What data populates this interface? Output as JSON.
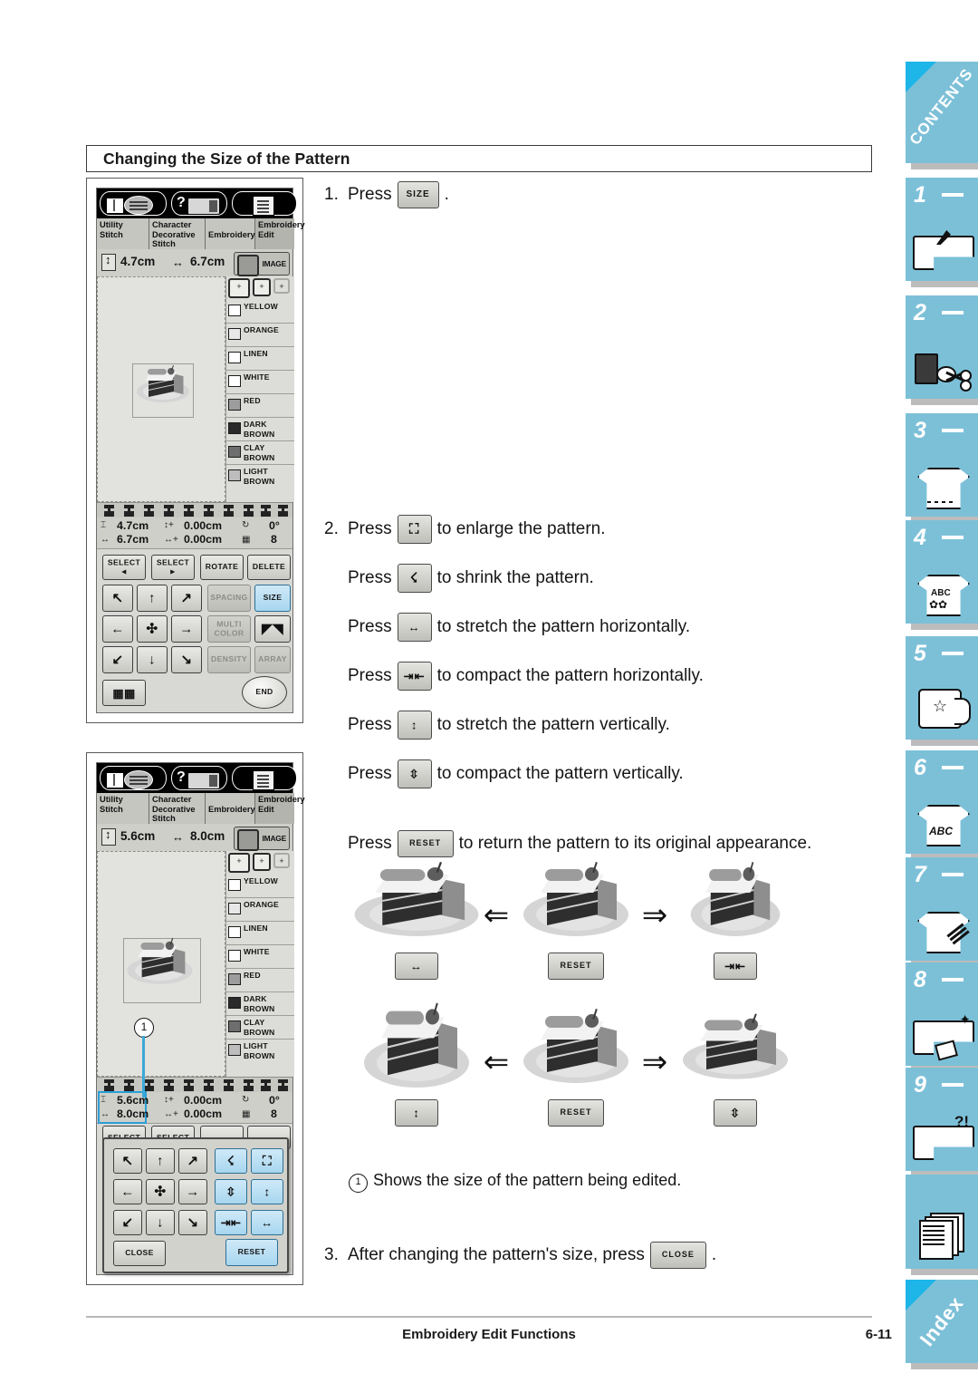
{
  "page": {
    "heading": "Changing the Size of the Pattern",
    "footer_title": "Embroidery Edit Functions",
    "footer_page": "6-11",
    "accent_blue": "#7cc0d8",
    "highlight_blue": "#a7d6ef",
    "corner_blue": "#1eb5e8"
  },
  "steps": {
    "s1_num": "1.",
    "s1_press": "Press",
    "s1_btn": "SIZE",
    "s1_end": ".",
    "s2_num": "2.",
    "s2_press": "Press",
    "s2_text": "to enlarge the pattern.",
    "s3_press": "Press",
    "s3_text": "to shrink the pattern.",
    "s4_press": "Press",
    "s4_text": "to stretch the pattern horizontally.",
    "s5_press": "Press",
    "s5_text": "to compact the pattern horizontally.",
    "s6_press": "Press",
    "s6_text": "to stretch the pattern vertically.",
    "s7_press": "Press",
    "s7_text": "to compact the pattern vertically.",
    "s8_press": "Press",
    "s8_btn": "RESET",
    "s8_text": "to return the pattern to its original appearance.",
    "note_marker": "1",
    "note_text": "Shows the size of the pattern being edited.",
    "s9_num": "3.",
    "s9_text": "After changing the pattern's size, press",
    "s9_btn": "CLOSE",
    "s9_end": "."
  },
  "screen1": {
    "tabs": [
      "Utility\nStitch",
      "Character\nDecorative\nStitch",
      "Embroidery",
      "Embroidery\nEdit"
    ],
    "tab_labels": [
      {
        "l1": "Utility",
        "l2": "Stitch",
        "l3": ""
      },
      {
        "l1": "Character",
        "l2": "Decorative",
        "l3": "Stitch"
      },
      {
        "l1": "Embroidery",
        "l2": "",
        "l3": ""
      },
      {
        "l1": "Embroidery",
        "l2": "Edit",
        "l3": ""
      }
    ],
    "size_height": "4.7cm",
    "size_width": "6.7cm",
    "image_button": "IMAGE",
    "colors": [
      "YELLOW",
      "ORANGE",
      "LINEN",
      "WHITE",
      "RED",
      "DARK\nBROWN",
      "CLAY\nBROWN",
      "LIGHT\nBROWN"
    ],
    "color_rows": [
      {
        "l1": "YELLOW",
        "l2": "",
        "swatch": "#ffffff"
      },
      {
        "l1": "ORANGE",
        "l2": "",
        "swatch": "#e8e8e8"
      },
      {
        "l1": "LINEN",
        "l2": "",
        "swatch": "#ffffff"
      },
      {
        "l1": "WHITE",
        "l2": "",
        "swatch": "#ffffff"
      },
      {
        "l1": "RED",
        "l2": "",
        "swatch": "#9d9d9d"
      },
      {
        "l1": "DARK",
        "l2": "BROWN",
        "swatch": "#2a2a2a"
      },
      {
        "l1": "CLAY",
        "l2": "BROWN",
        "swatch": "#6e6e6e"
      },
      {
        "l1": "LIGHT",
        "l2": "BROWN",
        "swatch": "#bdbdbd"
      }
    ],
    "readout": {
      "height": "4.7cm",
      "width": "6.7cm",
      "v_offset": "0.00cm",
      "h_offset": "0.00cm",
      "rotation": "0°",
      "count": "8"
    },
    "buttons": {
      "select_prev_l1": "SELECT",
      "select_prev_l2": "◄",
      "select_next_l1": "SELECT",
      "select_next_l2": "►",
      "rotate": "ROTATE",
      "delete": "DELETE",
      "spacing": "SPACING",
      "size": "SIZE",
      "multi_color_l1": "MULTI",
      "multi_color_l2": "COLOR",
      "density": "DENSITY",
      "array": "ARRAY",
      "end": "END"
    }
  },
  "screen2": {
    "tab_labels": [
      {
        "l1": "Utility",
        "l2": "Stitch",
        "l3": ""
      },
      {
        "l1": "Character",
        "l2": "Decorative",
        "l3": "Stitch"
      },
      {
        "l1": "Embroidery",
        "l2": "",
        "l3": ""
      },
      {
        "l1": "Embroidery",
        "l2": "Edit",
        "l3": ""
      }
    ],
    "size_height": "5.6cm",
    "size_width": "8.0cm",
    "image_button": "IMAGE",
    "color_rows": [
      {
        "l1": "YELLOW",
        "l2": "",
        "swatch": "#ffffff"
      },
      {
        "l1": "ORANGE",
        "l2": "",
        "swatch": "#e8e8e8"
      },
      {
        "l1": "LINEN",
        "l2": "",
        "swatch": "#ffffff"
      },
      {
        "l1": "WHITE",
        "l2": "",
        "swatch": "#ffffff"
      },
      {
        "l1": "RED",
        "l2": "",
        "swatch": "#9d9d9d"
      },
      {
        "l1": "DARK",
        "l2": "BROWN",
        "swatch": "#2a2a2a"
      },
      {
        "l1": "CLAY",
        "l2": "BROWN",
        "swatch": "#6e6e6e"
      },
      {
        "l1": "LIGHT",
        "l2": "BROWN",
        "swatch": "#bdbdbd"
      }
    ],
    "readout": {
      "height": "5.6cm",
      "width": "8.0cm",
      "v_offset": "0.00cm",
      "h_offset": "0.00cm",
      "rotation": "0°",
      "count": "8"
    },
    "behind_buttons": {
      "select_prev": "SELECT",
      "select_next": "SELECT"
    },
    "dialog_buttons": {
      "close": "CLOSE",
      "reset": "RESET"
    },
    "callout": "1"
  },
  "illustrations": {
    "row1": {
      "left_button": "stretch-horizontal",
      "center_button": "RESET",
      "right_button": "compact-horizontal",
      "left_arrow": "⇐",
      "right_arrow": "⇒"
    },
    "row2": {
      "left_button": "stretch-vertical",
      "center_button": "RESET",
      "right_button": "compact-vertical",
      "left_arrow": "⇐",
      "right_arrow": "⇒"
    }
  },
  "side_tabs": [
    {
      "label": "CONTENTS",
      "type": "diagonal",
      "num": "",
      "icon": ""
    },
    {
      "label": "",
      "type": "num",
      "num": "1",
      "icon": "sewing-machine-icon"
    },
    {
      "label": "",
      "type": "num",
      "num": "2",
      "icon": "thread-spool-icon"
    },
    {
      "label": "",
      "type": "num",
      "num": "3",
      "icon": "tshirt-icon"
    },
    {
      "label": "",
      "type": "num",
      "num": "4",
      "icon": "tshirt-abc-icon"
    },
    {
      "label": "",
      "type": "num",
      "num": "5",
      "icon": "hoop-star-icon"
    },
    {
      "label": "",
      "type": "num",
      "num": "6",
      "icon": "tshirt-abc2-icon"
    },
    {
      "label": "",
      "type": "num",
      "num": "7",
      "icon": "tshirt-quilt-icon"
    },
    {
      "label": "",
      "type": "num",
      "num": "8",
      "icon": "machine-clean-icon"
    },
    {
      "label": "",
      "type": "num",
      "num": "9",
      "icon": "machine-question-icon"
    },
    {
      "label": "",
      "type": "plain",
      "num": "",
      "icon": "documents-icon"
    },
    {
      "label": "Index",
      "type": "diagonal",
      "num": "",
      "icon": ""
    }
  ]
}
